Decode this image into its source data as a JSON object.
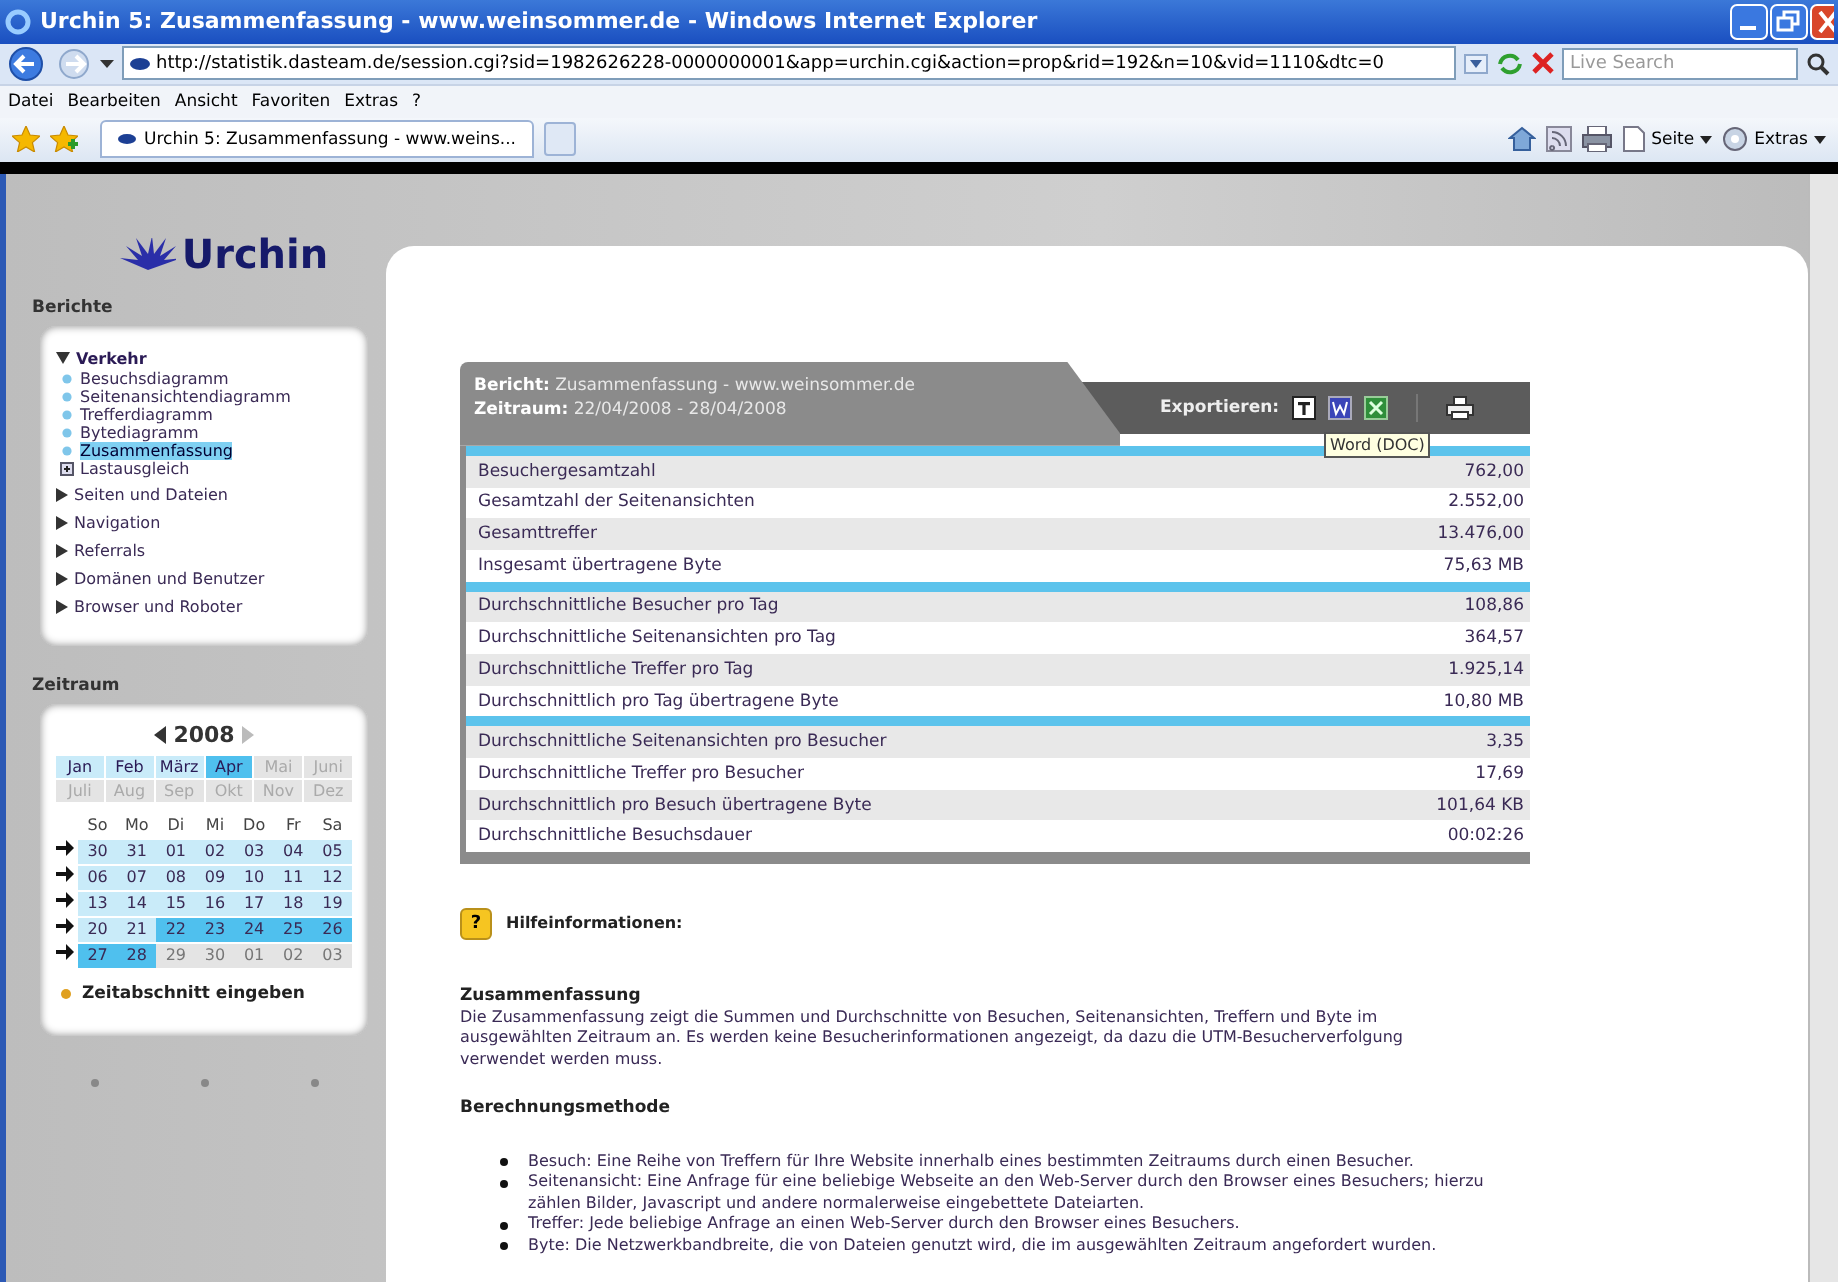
{
  "window": {
    "title": "Urchin 5: Zusammenfassung - www.weinsommer.de - Windows Internet Explorer"
  },
  "address_bar": {
    "url": "http://statistik.dasteam.de/session.cgi?sid=1982626228-0000000001&app=urchin.cgi&action=prop&rid=192&n=10&vid=1110&dtc=0",
    "search_placeholder": "Live Search"
  },
  "menu": [
    "Datei",
    "Bearbeiten",
    "Ansicht",
    "Favoriten",
    "Extras",
    "?"
  ],
  "tabs": [
    {
      "label": "Urchin 5: Zusammenfassung - www.weins...",
      "selected": true
    }
  ],
  "toolbar": [
    "Seite",
    "Extras"
  ],
  "sidebar": {
    "logo": "Urchin",
    "reports_heading": "Berichte",
    "tree": [
      {
        "label": "Verkehr",
        "expanded": true,
        "children": [
          {
            "label": "Besuchsdiagramm",
            "kind": "page",
            "selected": false
          },
          {
            "label": "Seitenansichtendiagramm",
            "kind": "page",
            "selected": false
          },
          {
            "label": "Trefferdiagramm",
            "kind": "page",
            "selected": false
          },
          {
            "label": "Bytediagramm",
            "kind": "page",
            "selected": false
          },
          {
            "label": "Zusammenfassung",
            "kind": "page",
            "selected": true
          },
          {
            "label": "Lastausgleich",
            "kind": "folder",
            "selected": false
          }
        ]
      },
      {
        "label": "Seiten und Dateien",
        "expanded": false
      },
      {
        "label": "Navigation",
        "expanded": false
      },
      {
        "label": "Referrals",
        "expanded": false
      },
      {
        "label": "Domänen und Benutzer",
        "expanded": false
      },
      {
        "label": "Browser und Roboter",
        "expanded": false
      }
    ],
    "period_heading": "Zeitraum",
    "calendar": {
      "year": "2008",
      "months": [
        {
          "label": "Jan",
          "available": true,
          "selected": false
        },
        {
          "label": "Feb",
          "available": true,
          "selected": false
        },
        {
          "label": "März",
          "available": true,
          "selected": false
        },
        {
          "label": "Apr",
          "available": true,
          "selected": true
        },
        {
          "label": "Mai",
          "available": false,
          "selected": false
        },
        {
          "label": "Juni",
          "available": false,
          "selected": false
        },
        {
          "label": "Juli",
          "available": false,
          "selected": false
        },
        {
          "label": "Aug",
          "available": false,
          "selected": false
        },
        {
          "label": "Sep",
          "available": false,
          "selected": false
        },
        {
          "label": "Okt",
          "available": false,
          "selected": false
        },
        {
          "label": "Nov",
          "available": false,
          "selected": false
        },
        {
          "label": "Dez",
          "available": false,
          "selected": false
        }
      ],
      "weekdays": [
        "So",
        "Mo",
        "Di",
        "Mi",
        "Do",
        "Fr",
        "Sa"
      ],
      "weeks": [
        [
          {
            "day": "30",
            "kind": "available"
          },
          {
            "day": "31",
            "kind": "available"
          },
          {
            "day": "01",
            "kind": "available"
          },
          {
            "day": "02",
            "kind": "available"
          },
          {
            "day": "03",
            "kind": "available"
          },
          {
            "day": "04",
            "kind": "available"
          },
          {
            "day": "05",
            "kind": "available"
          }
        ],
        [
          {
            "day": "06",
            "kind": "available"
          },
          {
            "day": "07",
            "kind": "available"
          },
          {
            "day": "08",
            "kind": "available"
          },
          {
            "day": "09",
            "kind": "available"
          },
          {
            "day": "10",
            "kind": "available"
          },
          {
            "day": "11",
            "kind": "available"
          },
          {
            "day": "12",
            "kind": "available"
          }
        ],
        [
          {
            "day": "13",
            "kind": "available"
          },
          {
            "day": "14",
            "kind": "available"
          },
          {
            "day": "15",
            "kind": "available"
          },
          {
            "day": "16",
            "kind": "available"
          },
          {
            "day": "17",
            "kind": "available"
          },
          {
            "day": "18",
            "kind": "available"
          },
          {
            "day": "19",
            "kind": "available"
          }
        ],
        [
          {
            "day": "20",
            "kind": "available"
          },
          {
            "day": "21",
            "kind": "available"
          },
          {
            "day": "22",
            "kind": "range"
          },
          {
            "day": "23",
            "kind": "range"
          },
          {
            "day": "24",
            "kind": "range"
          },
          {
            "day": "25",
            "kind": "range"
          },
          {
            "day": "26",
            "kind": "range"
          }
        ],
        [
          {
            "day": "27",
            "kind": "range"
          },
          {
            "day": "28",
            "kind": "range"
          },
          {
            "day": "29",
            "kind": "unavailable"
          },
          {
            "day": "30",
            "kind": "unavailable"
          },
          {
            "day": "01",
            "kind": "unavailable"
          },
          {
            "day": "02",
            "kind": "unavailable"
          },
          {
            "day": "03",
            "kind": "unavailable"
          }
        ]
      ]
    },
    "custom_range_link": "Zeitabschnitt eingeben"
  },
  "report": {
    "report_label": "Bericht:",
    "report_name": "Zusammenfassung - www.weinsommer.de",
    "period_label": "Zeitraum:",
    "period": "22/04/2008 - 28/04/2008",
    "export_label": "Exportieren:",
    "tooltip": "Word (DOC)",
    "groups": [
      [
        {
          "label": "Besuchergesamtzahl",
          "value": "762,00"
        },
        {
          "label": "Gesamtzahl der Seitenansichten",
          "value": "2.552,00"
        },
        {
          "label": "Gesamttreffer",
          "value": "13.476,00"
        },
        {
          "label": "Insgesamt übertragene Byte",
          "value": "75,63 MB"
        }
      ],
      [
        {
          "label": "Durchschnittliche Besucher pro Tag",
          "value": "108,86"
        },
        {
          "label": "Durchschnittliche Seitenansichten pro Tag",
          "value": "364,57"
        },
        {
          "label": "Durchschnittliche Treffer pro Tag",
          "value": "1.925,14"
        },
        {
          "label": "Durchschnittlich pro Tag übertragene Byte",
          "value": "10,80 MB"
        }
      ],
      [
        {
          "label": "Durchschnittliche Seitenansichten pro Besucher",
          "value": "3,35"
        },
        {
          "label": "Durchschnittliche Treffer pro Besucher",
          "value": "17,69"
        },
        {
          "label": "Durchschnittlich pro Besuch übertragene Byte",
          "value": "101,64 KB"
        },
        {
          "label": "Durchschnittliche Besuchsdauer",
          "value": "00:02:26"
        }
      ]
    ]
  },
  "help": {
    "icon_glyph": "?",
    "heading": "Hilfeinformationen:",
    "summary_title": "Zusammenfassung",
    "summary_text": "Die Zusammenfassung zeigt die Summen und Durchschnitte von Besuchen, Seitenansichten, Treffern und Byte im ausgewählten Zeitraum an. Es werden keine Besucherinformationen angezeigt, da dazu die UTM-Besucherverfolgung verwendet werden muss.",
    "method_title": "Berechnungsmethode",
    "bullets": [
      "Besuch: Eine Reihe von Treffern für Ihre Website innerhalb eines bestimmten Zeitraums durch einen Besucher.",
      "Seitenansicht: Eine Anfrage für eine beliebige Webseite an den Web-Server durch den Browser eines Besuchers; hierzu zählen Bilder, Javascript und andere normalerweise eingebettete Dateiarten.",
      "Treffer: Jede beliebige Anfrage an einen Web-Server durch den Browser eines Besuchers.",
      "Byte: Die Netzwerkbandbreite, die von Dateien genutzt wird, die im ausgewählten Zeitraum angefordert wurden."
    ]
  }
}
